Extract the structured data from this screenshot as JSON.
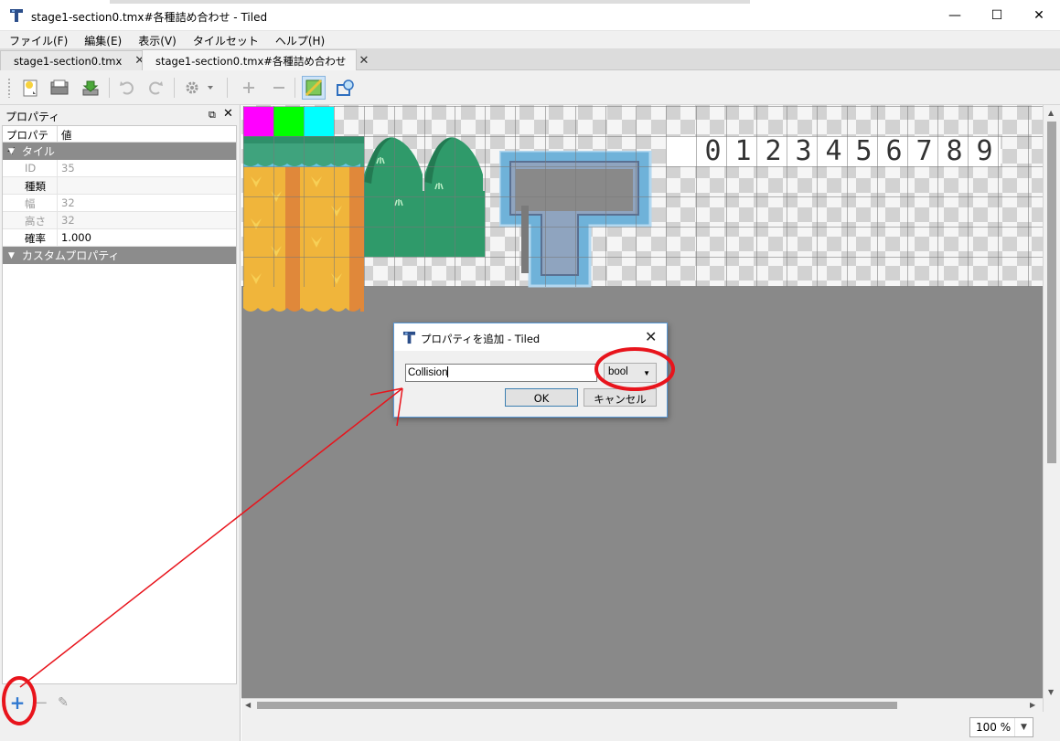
{
  "window": {
    "title": "stage1-section0.tmx#各種詰め合わせ - Tiled",
    "minimize_glyph": "—",
    "maximize_glyph": "☐",
    "close_glyph": "✕"
  },
  "menubar": {
    "items": [
      "ファイル(F)",
      "編集(E)",
      "表示(V)",
      "タイルセット",
      "ヘルプ(H)"
    ]
  },
  "tabs": [
    {
      "label": "stage1-section0.tmx",
      "close": "✕",
      "active": false
    },
    {
      "label": "stage1-section0.tmx#各種詰め合わせ",
      "close": "✕",
      "active": true
    }
  ],
  "toolbar": {
    "icons": [
      "new-file-icon",
      "open-folder-icon",
      "save-icon",
      "undo-icon",
      "redo-icon",
      "settings-icon",
      "add-icon",
      "remove-icon",
      "tileset-edit-icon",
      "collision-shape-icon"
    ]
  },
  "properties_panel": {
    "title": "プロパティ",
    "float_glyph": "⧉",
    "close_glyph": "✕",
    "header": {
      "col1": "プロパティ",
      "col2": "値"
    },
    "group_tile": "タイル",
    "rows": [
      {
        "key": "ID",
        "value": "35",
        "disabled": true
      },
      {
        "key": "種類",
        "value": "",
        "disabled": false
      },
      {
        "key": "幅",
        "value": "32",
        "disabled": true
      },
      {
        "key": "高さ",
        "value": "32",
        "disabled": true
      },
      {
        "key": "確率",
        "value": "1.000",
        "disabled": false
      }
    ],
    "group_custom": "カスタムプロパティ",
    "add_glyph": "+",
    "remove_glyph": "−",
    "rename_glyph": "✎"
  },
  "tileset": {
    "digits": [
      "0",
      "1",
      "2",
      "3",
      "4",
      "5",
      "6",
      "7",
      "8",
      "9"
    ],
    "swatch_colors": [
      "#ff00ff",
      "#00ff00",
      "#00ffff"
    ]
  },
  "statusbar": {
    "zoom": "100 %"
  },
  "dialog": {
    "title": "プロパティを追加 - Tiled",
    "close_glyph": "✕",
    "name_value": "Collision",
    "type_value": "bool",
    "ok_label": "OK",
    "cancel_label": "キャンセル"
  },
  "colors": {
    "annotation": "#e8141c",
    "canvas_bg": "#898989",
    "group_row": "#8c8c8c"
  }
}
